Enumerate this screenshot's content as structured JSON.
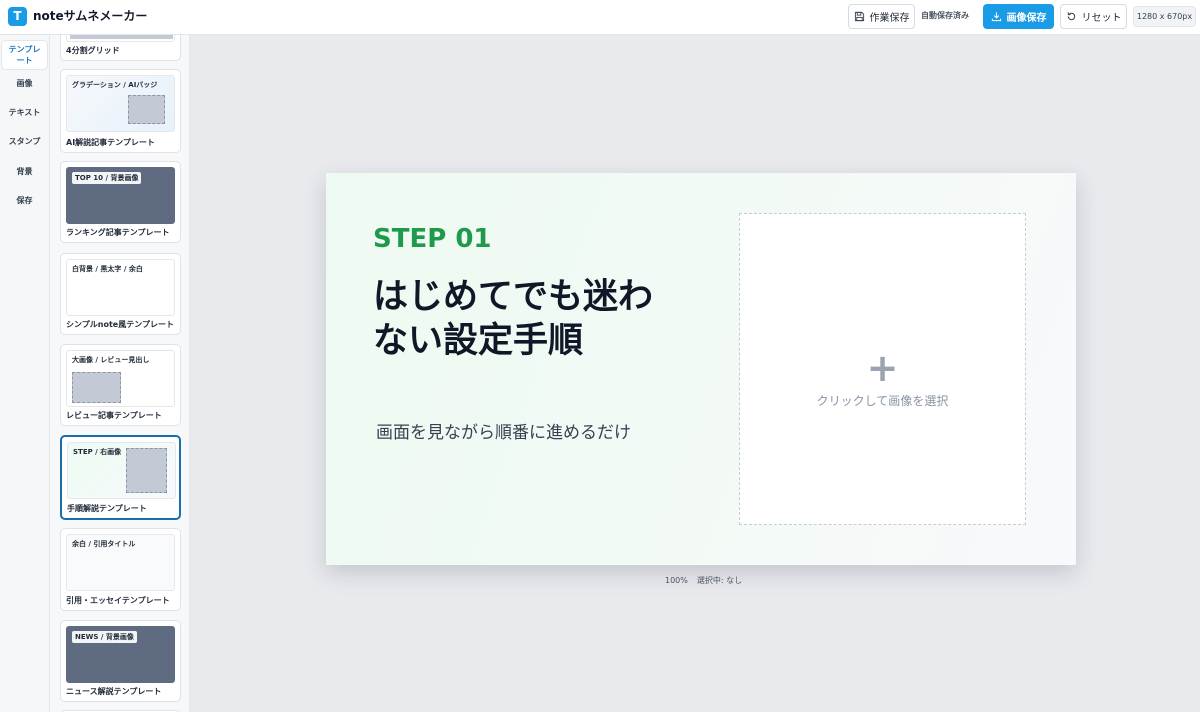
{
  "header": {
    "logo_letter": "T",
    "app_title": "noteサムネメーカー",
    "save_work_label": "作業保存",
    "autosave_status": "自動保存済み",
    "save_image_label": "画像保存",
    "reset_label": "リセット",
    "canvas_size": "1280 x 670px"
  },
  "nav": {
    "items": [
      {
        "label": "テンプレート",
        "active": true
      },
      {
        "label": "画像"
      },
      {
        "label": "テキスト"
      },
      {
        "label": "スタンプ"
      },
      {
        "label": "背景"
      },
      {
        "label": "保存"
      }
    ]
  },
  "templates": [
    {
      "thumb_tag": "",
      "label": "4分割グリッド"
    },
    {
      "thumb_tag": "グラデーション / AIバッジ",
      "label": "AI解説記事テンプレート"
    },
    {
      "thumb_tag": "TOP 10 / 背景画像",
      "label": "ランキング記事テンプレート"
    },
    {
      "thumb_tag": "白背景 / 黒太字 / 余白",
      "label": "シンプルnote風テンプレート"
    },
    {
      "thumb_tag": "大画像 / レビュー見出し",
      "label": "レビュー記事テンプレート"
    },
    {
      "thumb_tag": "STEP / 右画像",
      "label": "手順解説テンプレート",
      "selected": true
    },
    {
      "thumb_tag": "余白 / 引用タイトル",
      "label": "引用・エッセイテンプレート"
    },
    {
      "thumb_tag": "NEWS / 背景画像",
      "label": "ニュース解説テンプレート"
    }
  ],
  "canvas": {
    "step": "STEP 01",
    "headline": "はじめてでも迷わない設定手順",
    "subline": "画面を見ながら順番に進めるだけ",
    "image_plus": "+",
    "image_placeholder": "クリックして画像を選択"
  },
  "status": {
    "zoom": "100%",
    "selection": "選択中: なし"
  },
  "colors": {
    "accent": "#1a9be6",
    "step_green": "#1f9a4d",
    "selected_border": "#1a6ea8"
  }
}
